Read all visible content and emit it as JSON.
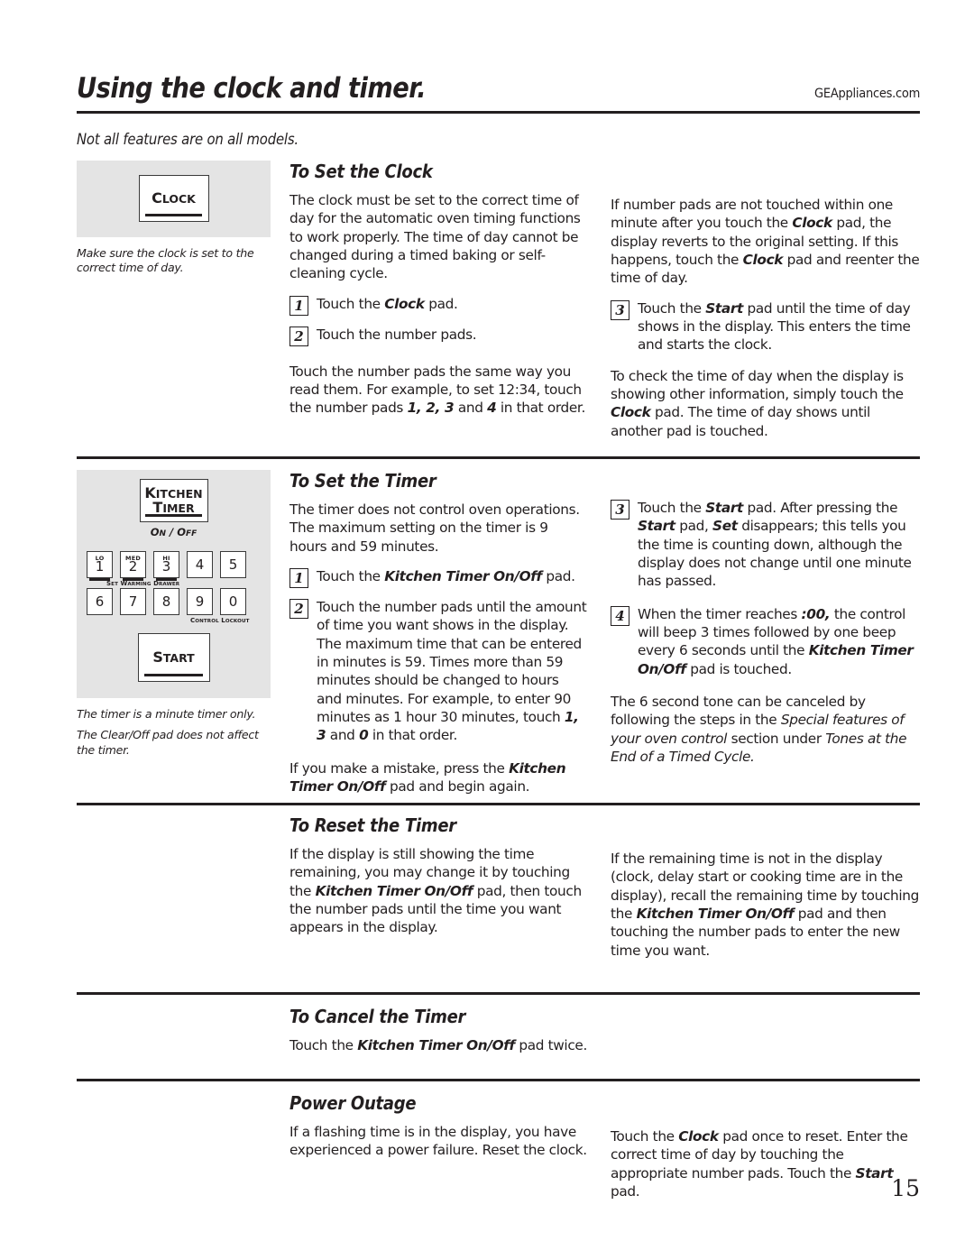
{
  "header": {
    "title": "Using the clock and timer.",
    "site_url": "GEAppliances.com",
    "subtitle": "Not all features are on all models."
  },
  "page_number": "15",
  "sections": [
    {
      "id": "set-clock",
      "heading": "To Set the Clock",
      "art": {
        "pad_label": "CLOCK",
        "caption": "Make sure the clock is set to the correct time of day."
      },
      "left_col": {
        "intro": "The clock must be set to the correct time of day for the automatic oven timing functions to work properly. The time of day cannot be changed during a timed baking or self-cleaning cycle.",
        "steps": [
          {
            "num": "1",
            "text": "Touch the Clock pad."
          },
          {
            "num": "2",
            "text": "Touch the number pads."
          }
        ],
        "outro": "Touch the number pads the same way you read them. For example, to set 12:34, touch the number pads 1, 2, 3 and 4 in that order."
      },
      "right_col": {
        "intro": "If number pads are not touched within one minute after you touch the Clock pad, the display reverts to the original setting. If this happens, touch the Clock pad and reenter the time of day.",
        "steps": [
          {
            "num": "3",
            "text": "Touch the Start pad until the time of day shows in the display. This enters the time and starts the clock."
          }
        ],
        "outro": "To check the time of day when the display is showing other information, simply touch the Clock pad. The time of day shows until another pad is touched."
      }
    },
    {
      "id": "set-timer",
      "heading": "To Set the Timer",
      "art": {
        "kitchen_timer_line1": "KITCHEN",
        "kitchen_timer_line2": "TIMER",
        "on_off_label": "ON / OFF",
        "start_label": "START",
        "keys_row1": [
          {
            "digit": "1",
            "mini": "LO"
          },
          {
            "digit": "2",
            "mini": "MED"
          },
          {
            "digit": "3",
            "mini": "HI"
          },
          {
            "digit": "4",
            "mini": ""
          },
          {
            "digit": "5",
            "mini": ""
          }
        ],
        "keys_row2": [
          {
            "digit": "6",
            "mini": ""
          },
          {
            "digit": "7",
            "mini": ""
          },
          {
            "digit": "8",
            "mini": ""
          },
          {
            "digit": "9",
            "mini": ""
          },
          {
            "digit": "0",
            "mini": ""
          }
        ],
        "caption_warming_drawer": "SET WARMING DRAWER",
        "caption_control_lockout": "CONTROL LOCKOUT",
        "caption_line1": "The timer is a minute timer only.",
        "caption_line2": "The Clear/Off pad does not affect the timer."
      },
      "left_col": {
        "intro": "The timer does not control oven operations. The maximum setting on the timer is 9 hours and 59 minutes.",
        "steps": [
          {
            "num": "1",
            "text": "Touch the Kitchen Timer On/Off pad."
          },
          {
            "num": "2",
            "text": "Touch the number pads until the amount of time you want shows in the display. The maximum time that can be entered in minutes is 59. Times more than 59 minutes should be changed to hours and minutes. For example, to enter 90 minutes as 1 hour 30 minutes, touch 1, 3 and 0 in that order."
          }
        ],
        "outro": "If you make a mistake, press the Kitchen Timer On/Off pad and begin again."
      },
      "right_col": {
        "steps": [
          {
            "num": "3",
            "text": "Touch the Start pad. After pressing the Start pad, Set disappears; this tells you the time is counting down, although the display does not change until one minute has passed."
          },
          {
            "num": "4",
            "text": "When the timer reaches :00, the control will beep 3 times followed by one beep every 6 seconds until the Kitchen Timer On/Off pad is touched."
          }
        ],
        "outro": "The 6 second tone can be canceled by following the steps in the Special features of your oven control section under Tones at the End of a Timed Cycle."
      }
    },
    {
      "id": "reset-timer",
      "heading": "To Reset the Timer",
      "left_col": {
        "intro": "If the display is still showing the time remaining, you may change it by touching the Kitchen Timer On/Off pad, then touch the number pads until the time you want appears in the display."
      },
      "right_col": {
        "intro": "If the remaining time is not in the display (clock, delay start or cooking time are in the display), recall the remaining time by touching the Kitchen Timer On/Off pad and then touching the number pads to enter the new time you want."
      }
    },
    {
      "id": "cancel-timer",
      "heading": "To Cancel the Timer",
      "left_col": {
        "intro": "Touch the Kitchen Timer On/Off pad twice."
      }
    },
    {
      "id": "power-outage",
      "heading": "Power Outage",
      "left_col": {
        "intro": "If a flashing time is in the display, you have experienced a power failure. Reset the clock."
      },
      "right_col": {
        "intro": "Touch the Clock pad once to reset. Enter the correct time of day by touching the appropriate number pads. Touch the Start pad."
      }
    }
  ]
}
